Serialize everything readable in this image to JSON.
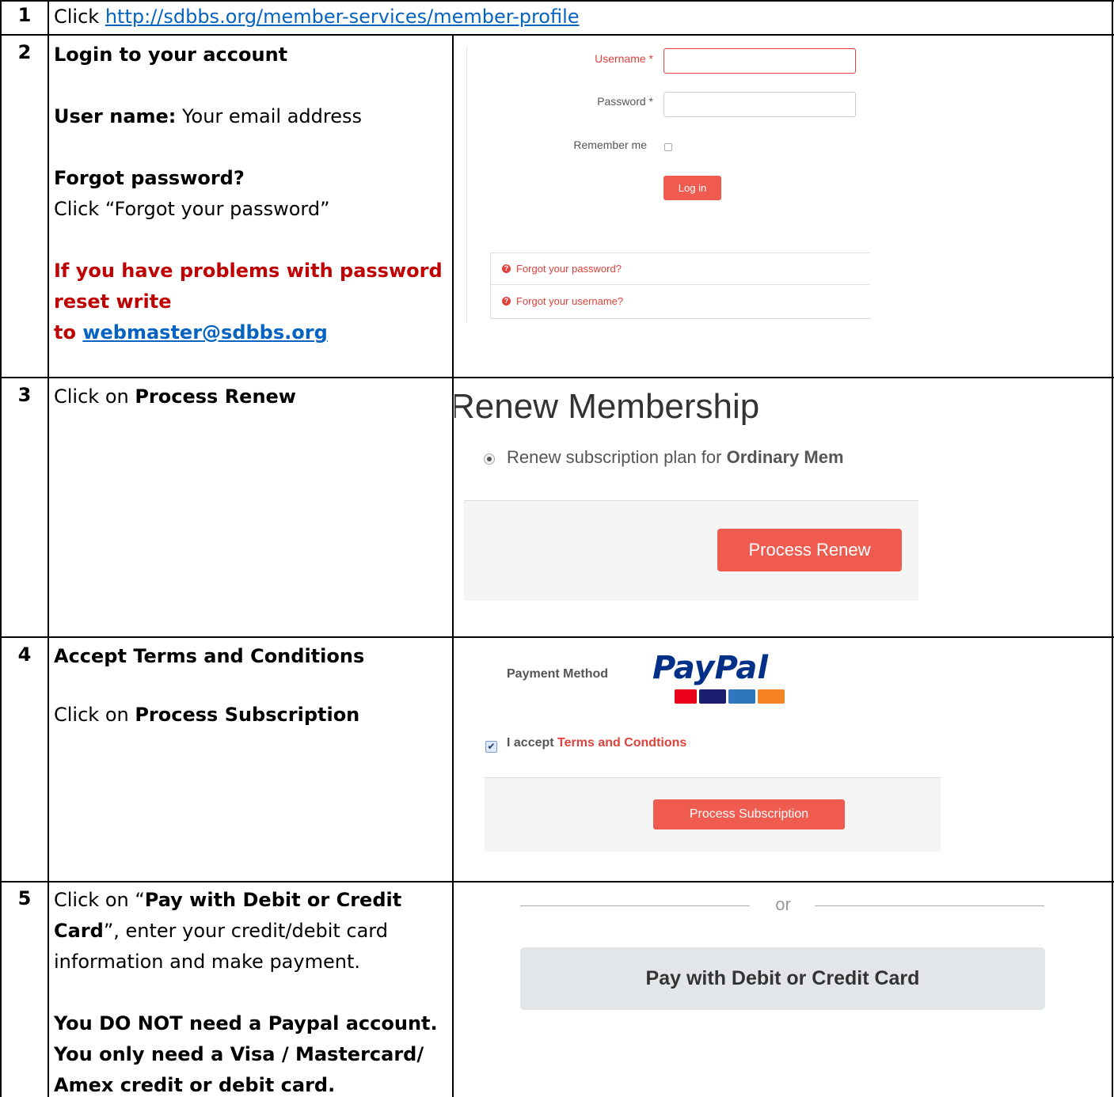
{
  "rows": [
    {
      "num": "1",
      "prefix": "Click ",
      "link": "http://sdbbs.org/member-services/member-profile"
    },
    {
      "num": "2",
      "heading": "Login to your account",
      "user_label": "User name:",
      "user_value": " Your email address",
      "forgot_heading": "Forgot password?",
      "forgot_text": "Click “Forgot your password”",
      "problem_line1": "If you have problems with password",
      "problem_line2": "reset write",
      "problem_to": "to ",
      "problem_email": "webmaster@sdbbs.org",
      "ui": {
        "username_label": "Username *",
        "password_label": "Password *",
        "remember_label": "Remember me",
        "login_button": "Log in",
        "forgot_password_link": "Forgot your password?",
        "forgot_username_link": "Forgot your username?"
      }
    },
    {
      "num": "3",
      "prefix": "Click on ",
      "bold": "Process Renew",
      "ui": {
        "title": "Renew Membership",
        "radio_text": "Renew subscription plan for ",
        "radio_bold": "Ordinary Mem",
        "button": "Process Renew"
      }
    },
    {
      "num": "4",
      "heading": "Accept Terms and Conditions",
      "prefix": "Click on ",
      "bold": "Process Subscription",
      "ui": {
        "payment_label": "Payment Method",
        "paypal_logo": "PayPal",
        "accept_text": "I accept ",
        "terms_link": "Terms and Condtions",
        "button": "Process Subscription"
      }
    },
    {
      "num": "5",
      "line1_prefix": "Click on “",
      "line1_bold": "Pay with Debit or Credit",
      "line2_bold": "Card",
      "line2_rest": "”, enter your credit/debit card",
      "line3": "information and make payment.",
      "note1": "You DO NOT need a Paypal account.",
      "note2": "You only need a Visa / Mastercard/",
      "note3": "Amex credit or debit card.",
      "ui": {
        "or_text": "or",
        "pay_button": "Pay with Debit or Credit Card"
      }
    }
  ],
  "colors": {
    "accent_red": "#f05b4f",
    "text_red": "#c00000",
    "link_blue": "#0563c1",
    "paypal_dark": "#003087",
    "paypal_light": "#009cde"
  }
}
